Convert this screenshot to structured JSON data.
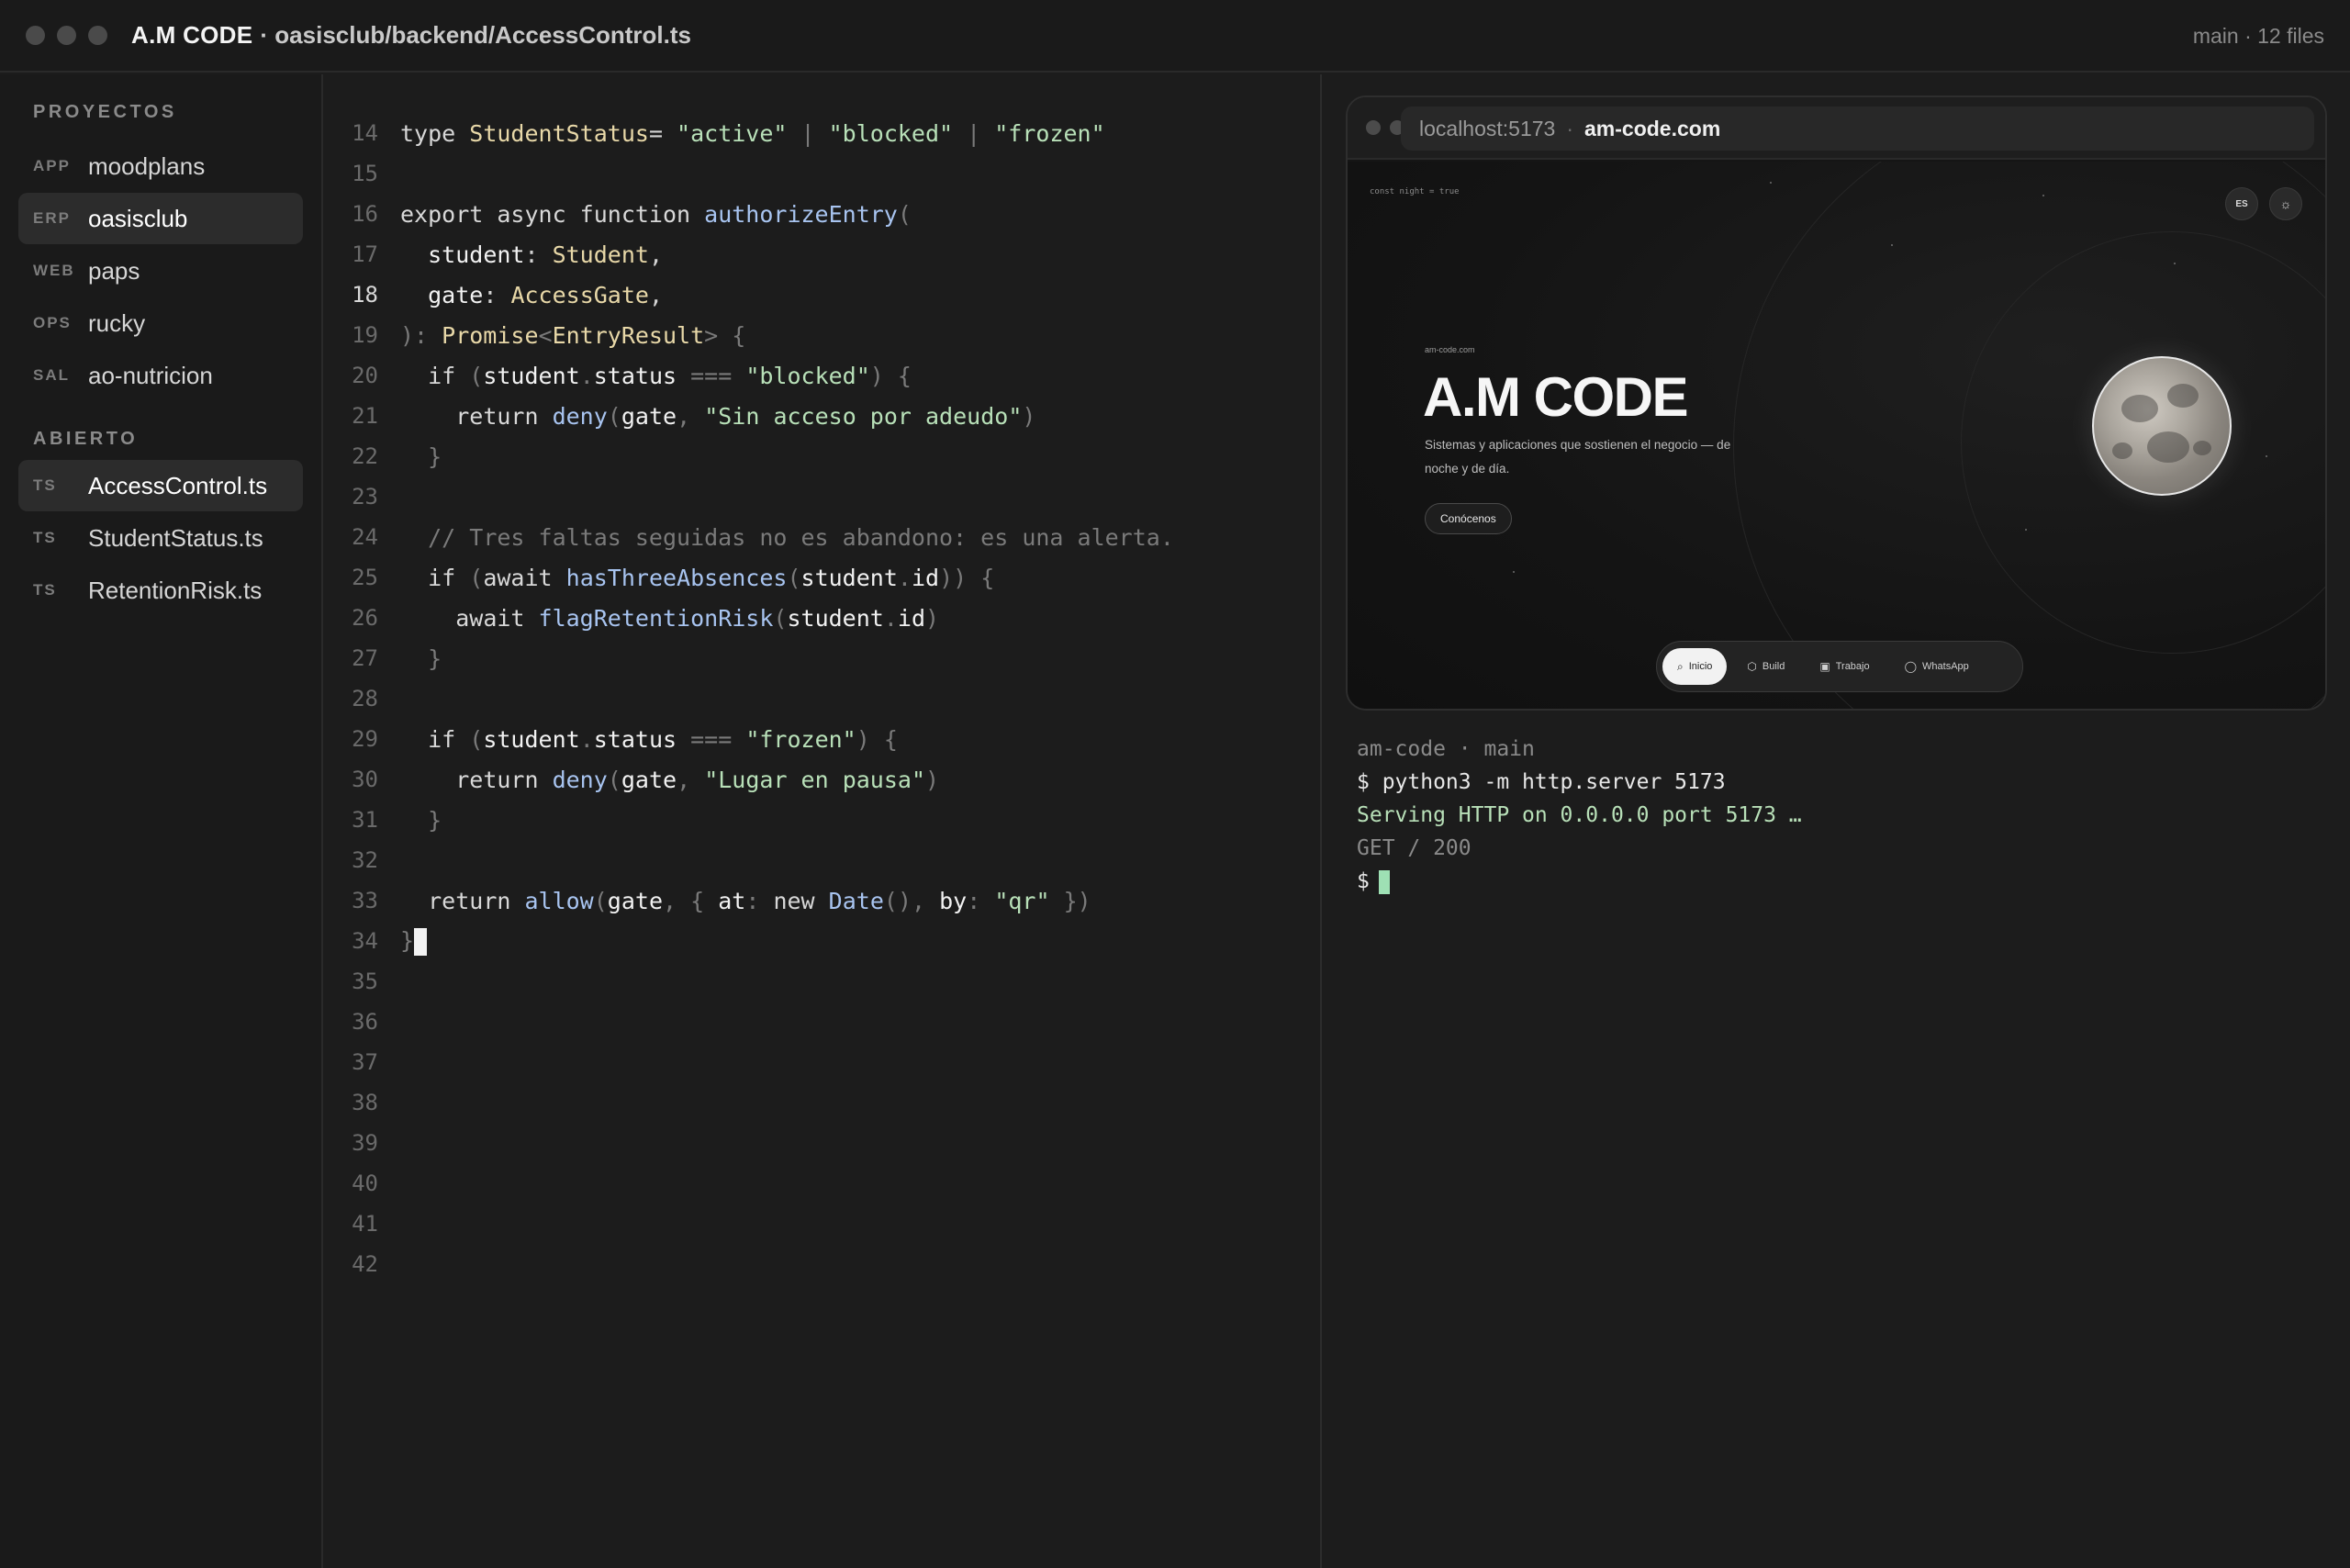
{
  "titlebar": {
    "brand": "A.M CODE",
    "path": "· oasisclub/backend/AccessControl.ts",
    "status": "main · 12 files"
  },
  "sidebar": {
    "projects_heading": "PROYECTOS",
    "projects": [
      {
        "tag": "APP",
        "label": "moodplans",
        "active": false
      },
      {
        "tag": "ERP",
        "label": "oasisclub",
        "active": true
      },
      {
        "tag": "WEB",
        "label": "paps",
        "active": false
      },
      {
        "tag": "OPS",
        "label": "rucky",
        "active": false
      },
      {
        "tag": "SAL",
        "label": "ao-nutricion",
        "active": false
      }
    ],
    "open_heading": "ABIERTO",
    "open_files": [
      {
        "tag": "TS",
        "label": "AccessControl.ts",
        "active": true
      },
      {
        "tag": "TS",
        "label": "StudentStatus.ts",
        "active": false
      },
      {
        "tag": "TS",
        "label": "RetentionRisk.ts",
        "active": false
      }
    ]
  },
  "editor": {
    "current_line": 18,
    "lines": [
      {
        "n": "14",
        "tokens": [
          [
            "kw",
            "type "
          ],
          [
            "ty",
            "StudentStatus"
          ],
          [
            "",
            "= "
          ],
          [
            "str",
            "\"active\""
          ],
          [
            "cmt",
            " | "
          ],
          [
            "str",
            "\"blocked\""
          ],
          [
            "cmt",
            " | "
          ],
          [
            "str",
            "\"frozen\""
          ]
        ]
      },
      {
        "n": "15",
        "tokens": []
      },
      {
        "n": "16",
        "tokens": [
          [
            "kw",
            "export async function "
          ],
          [
            "fn",
            "authorizeEntry"
          ],
          [
            "cmt",
            "("
          ]
        ]
      },
      {
        "n": "17",
        "tokens": [
          [
            "",
            "  "
          ],
          [
            "prop",
            "student"
          ],
          [
            "",
            ": "
          ],
          [
            "ty",
            "Student"
          ],
          [
            "",
            ","
          ]
        ]
      },
      {
        "n": "18",
        "tokens": [
          [
            "",
            "  "
          ],
          [
            "prop",
            "gate"
          ],
          [
            "",
            ": "
          ],
          [
            "ty",
            "AccessGate"
          ],
          [
            "",
            ","
          ]
        ]
      },
      {
        "n": "19",
        "tokens": [
          [
            "cmt",
            "): "
          ],
          [
            "ty",
            "Promise"
          ],
          [
            "cmt",
            "<"
          ],
          [
            "ty",
            "EntryResult"
          ],
          [
            "cmt",
            "> {"
          ]
        ]
      },
      {
        "n": "20",
        "tokens": [
          [
            "",
            "  "
          ],
          [
            "kw",
            "if "
          ],
          [
            "cmt",
            "("
          ],
          [
            "prop",
            "student"
          ],
          [
            "cmt",
            "."
          ],
          [
            "prop",
            "status"
          ],
          [
            "cmt",
            " === "
          ],
          [
            "str",
            "\"blocked\""
          ],
          [
            "cmt",
            ") {"
          ]
        ]
      },
      {
        "n": "21",
        "tokens": [
          [
            "",
            "    "
          ],
          [
            "kw",
            "return "
          ],
          [
            "fn",
            "deny"
          ],
          [
            "cmt",
            "("
          ],
          [
            "prop",
            "gate"
          ],
          [
            "cmt",
            ", "
          ],
          [
            "str",
            "\"Sin acceso por adeudo\""
          ],
          [
            "cmt",
            ")"
          ]
        ]
      },
      {
        "n": "22",
        "tokens": [
          [
            "",
            "  "
          ],
          [
            "cmt",
            "}"
          ]
        ]
      },
      {
        "n": "23",
        "tokens": []
      },
      {
        "n": "24",
        "tokens": [
          [
            "",
            "  "
          ],
          [
            "cmt",
            "// Tres faltas seguidas no es abandono: es una alerta."
          ]
        ]
      },
      {
        "n": "25",
        "tokens": [
          [
            "",
            "  "
          ],
          [
            "kw",
            "if "
          ],
          [
            "cmt",
            "("
          ],
          [
            "kw",
            "await "
          ],
          [
            "fn",
            "hasThreeAbsences"
          ],
          [
            "cmt",
            "("
          ],
          [
            "prop",
            "student"
          ],
          [
            "cmt",
            "."
          ],
          [
            "prop",
            "id"
          ],
          [
            "cmt",
            ")) {"
          ]
        ]
      },
      {
        "n": "26",
        "tokens": [
          [
            "",
            "    "
          ],
          [
            "kw",
            "await "
          ],
          [
            "fn",
            "flagRetentionRisk"
          ],
          [
            "cmt",
            "("
          ],
          [
            "prop",
            "student"
          ],
          [
            "cmt",
            "."
          ],
          [
            "prop",
            "id"
          ],
          [
            "cmt",
            ")"
          ]
        ]
      },
      {
        "n": "27",
        "tokens": [
          [
            "",
            "  "
          ],
          [
            "cmt",
            "}"
          ]
        ]
      },
      {
        "n": "28",
        "tokens": []
      },
      {
        "n": "29",
        "tokens": [
          [
            "",
            "  "
          ],
          [
            "kw",
            "if "
          ],
          [
            "cmt",
            "("
          ],
          [
            "prop",
            "student"
          ],
          [
            "cmt",
            "."
          ],
          [
            "prop",
            "status"
          ],
          [
            "cmt",
            " === "
          ],
          [
            "str",
            "\"frozen\""
          ],
          [
            "cmt",
            ") {"
          ]
        ]
      },
      {
        "n": "30",
        "tokens": [
          [
            "",
            "    "
          ],
          [
            "kw",
            "return "
          ],
          [
            "fn",
            "deny"
          ],
          [
            "cmt",
            "("
          ],
          [
            "prop",
            "gate"
          ],
          [
            "cmt",
            ", "
          ],
          [
            "str",
            "\"Lugar en pausa\""
          ],
          [
            "cmt",
            ")"
          ]
        ]
      },
      {
        "n": "31",
        "tokens": [
          [
            "",
            "  "
          ],
          [
            "cmt",
            "}"
          ]
        ]
      },
      {
        "n": "32",
        "tokens": []
      },
      {
        "n": "33",
        "tokens": [
          [
            "",
            "  "
          ],
          [
            "kw",
            "return "
          ],
          [
            "fn",
            "allow"
          ],
          [
            "cmt",
            "("
          ],
          [
            "prop",
            "gate"
          ],
          [
            "cmt",
            ", { "
          ],
          [
            "prop",
            "at"
          ],
          [
            "cmt",
            ": "
          ],
          [
            "kw",
            "new "
          ],
          [
            "fn",
            "Date"
          ],
          [
            "cmt",
            "(), "
          ],
          [
            "prop",
            "by"
          ],
          [
            "cmt",
            ": "
          ],
          [
            "str",
            "\"qr\""
          ],
          [
            "cmt",
            " })"
          ]
        ]
      },
      {
        "n": "34",
        "tokens": [
          [
            "cmt",
            "}"
          ]
        ],
        "cursor": true
      },
      {
        "n": "35",
        "tokens": []
      },
      {
        "n": "36",
        "tokens": []
      },
      {
        "n": "37",
        "tokens": []
      },
      {
        "n": "38",
        "tokens": []
      },
      {
        "n": "39",
        "tokens": []
      },
      {
        "n": "40",
        "tokens": []
      },
      {
        "n": "41",
        "tokens": []
      },
      {
        "n": "42",
        "tokens": []
      }
    ]
  },
  "browser": {
    "url_host": "localhost:5173",
    "url_sep": "·",
    "url_site": "am-code.com",
    "page": {
      "snippet": "const night = true",
      "lang_button": "ES",
      "theme_icon": "☼",
      "kicker": "am-code.com",
      "title": "A.M CODE",
      "subtitle": "Sistemas y aplicaciones que sostienen el negocio — de noche y de día.",
      "cta": "Conócenos",
      "nav": [
        {
          "icon": "search-icon",
          "glyph": "⌕",
          "label": "Inicio",
          "active": true
        },
        {
          "icon": "cube-icon",
          "glyph": "⬡",
          "label": "Build",
          "active": false
        },
        {
          "icon": "briefcase-icon",
          "glyph": "▣",
          "label": "Trabajo",
          "active": false
        },
        {
          "icon": "whatsapp-icon",
          "glyph": "◯",
          "label": "WhatsApp",
          "active": false
        }
      ]
    }
  },
  "terminal": {
    "meta": "am-code · main",
    "command": "$ python3 -m http.server 5173",
    "serving": "Serving HTTP on 0.0.0.0 port 5173 …",
    "log": "GET / 200",
    "prompt": "$"
  },
  "colors": {
    "background": "#1c1c1c",
    "string": "#b8e0b8",
    "function": "#a8c4f0",
    "type": "#e8d8a8",
    "terminal_cursor": "#9ee0b4"
  }
}
